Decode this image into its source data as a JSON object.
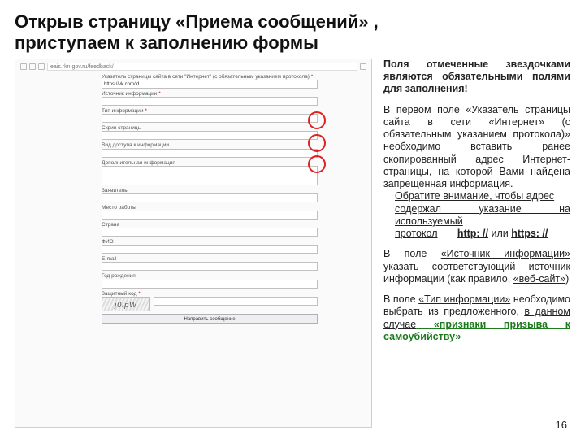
{
  "title_line1": "Открыв страницу «Приема сообщений» ,",
  "title_line2": "приступаем к заполнению формы",
  "browser": {
    "address": "eais.rkn.gov.ru/feedback/"
  },
  "form": {
    "field_url": {
      "label": "Указатель страницы сайта в сети \"Интернет\" (с обязательным указанием протокола)",
      "value": "https://vk.com/id...",
      "star": "*"
    },
    "field_source": {
      "label": "Источник информации",
      "star": "*"
    },
    "field_type": {
      "label": "Тип информации",
      "star": "*"
    },
    "field_screenshot": {
      "label": "Скрин страницы"
    },
    "field_access": {
      "label": "Вид доступа к информации"
    },
    "field_other": {
      "label": "Дополнительная информация"
    },
    "field_applicant": {
      "label": "Заявитель"
    },
    "field_work": {
      "label": "Место работы"
    },
    "field_country": {
      "label": "Страна"
    },
    "field_fio": {
      "label": "ФИО"
    },
    "field_email": {
      "label": "E-mail"
    },
    "field_year": {
      "label": "Год рождения"
    },
    "captcha": {
      "label": "Защитный код",
      "img": "j0ipW",
      "star": "*"
    },
    "submit": "Направить сообщение"
  },
  "side": {
    "p0": "Поля отмеченные звездочками являются обязательными полями для заполнения!",
    "p1a": "В первом поле «Указатель страницы сайта в сети «Интернет» (с обязательным указанием протокола)» необходимо вставить ранее скопированный адрес Интернет-страницы, на которой Вами найдена запрещенная информация.",
    "p1b": "Обратите внимание, чтобы адрес",
    "p1c": "содержал указание на используемый",
    "p1d": "протокол",
    "p1e": "http: //",
    "p1f": " или ",
    "p1g": "https: //",
    "p2a": "В поле ",
    "p2b": "«Источник информации»",
    "p2c": " указать соответствующий источник информации (как правило, ",
    "p2d": "«веб-сайт»",
    "p2e": ")",
    "p3a": "В поле ",
    "p3b": "«Тип информации»",
    "p3c": " необходимо выбрать из предложенного, ",
    "p3d": "в данном случае",
    "p3e": " «признаки призыва к самоубийству»"
  },
  "page_number": "16"
}
